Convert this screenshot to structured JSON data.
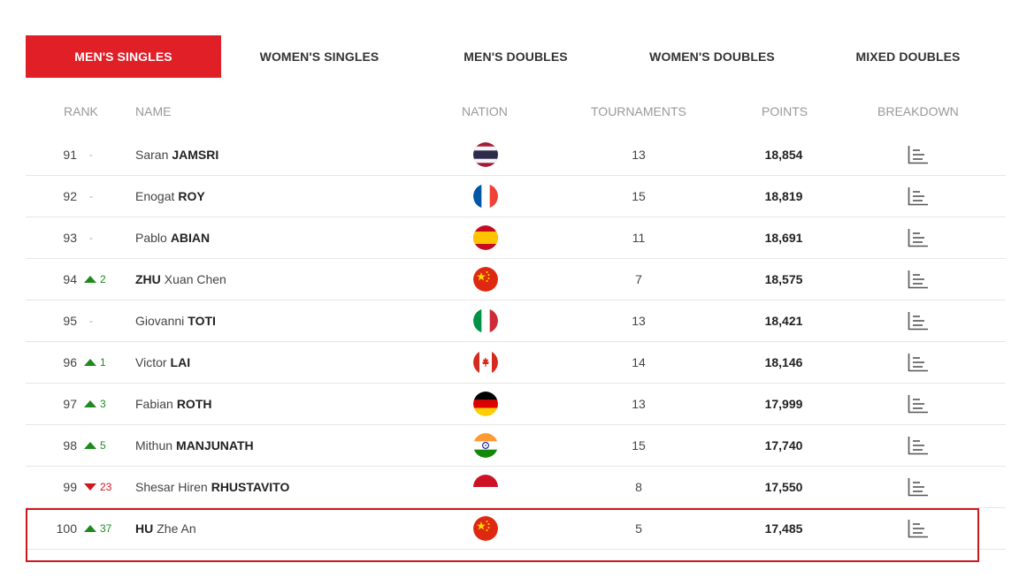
{
  "tabs": [
    {
      "label": "MEN'S SINGLES",
      "active": true
    },
    {
      "label": "WOMEN'S SINGLES",
      "active": false
    },
    {
      "label": "MEN'S DOUBLES",
      "active": false
    },
    {
      "label": "WOMEN'S DOUBLES",
      "active": false
    },
    {
      "label": "MIXED DOUBLES",
      "active": false
    }
  ],
  "columns": {
    "rank": "RANK",
    "name": "NAME",
    "nation": "NATION",
    "tournaments": "TOURNAMENTS",
    "points": "POINTS",
    "breakdown": "BREAKDOWN"
  },
  "rows": [
    {
      "rank": "91",
      "move_dir": "none",
      "move": "-",
      "name_first": "Saran",
      "name_first_bold": false,
      "name_last": "JAMSRI",
      "flag": "thailand",
      "tournaments": "13",
      "points": "18,854"
    },
    {
      "rank": "92",
      "move_dir": "none",
      "move": "-",
      "name_first": "Enogat",
      "name_first_bold": false,
      "name_last": "ROY",
      "flag": "france",
      "tournaments": "15",
      "points": "18,819"
    },
    {
      "rank": "93",
      "move_dir": "none",
      "move": "-",
      "name_first": "Pablo",
      "name_first_bold": false,
      "name_last": "ABIAN",
      "flag": "spain",
      "tournaments": "11",
      "points": "18,691"
    },
    {
      "rank": "94",
      "move_dir": "up",
      "move": "2",
      "name_first": "ZHU",
      "name_first_bold": true,
      "name_last": "Xuan Chen",
      "flag": "china",
      "tournaments": "7",
      "points": "18,575"
    },
    {
      "rank": "95",
      "move_dir": "none",
      "move": "-",
      "name_first": "Giovanni",
      "name_first_bold": false,
      "name_last": "TOTI",
      "flag": "italy",
      "tournaments": "13",
      "points": "18,421"
    },
    {
      "rank": "96",
      "move_dir": "up",
      "move": "1",
      "name_first": "Victor",
      "name_first_bold": false,
      "name_last": "LAI",
      "flag": "canada",
      "tournaments": "14",
      "points": "18,146"
    },
    {
      "rank": "97",
      "move_dir": "up",
      "move": "3",
      "name_first": "Fabian",
      "name_first_bold": false,
      "name_last": "ROTH",
      "flag": "germany",
      "tournaments": "13",
      "points": "17,999"
    },
    {
      "rank": "98",
      "move_dir": "up",
      "move": "5",
      "name_first": "Mithun",
      "name_first_bold": false,
      "name_last": "MANJUNATH",
      "flag": "india",
      "tournaments": "15",
      "points": "17,740"
    },
    {
      "rank": "99",
      "move_dir": "down",
      "move": "23",
      "name_first": "Shesar Hiren",
      "name_first_bold": false,
      "name_last": "RHUSTAVITO",
      "flag": "indonesia",
      "tournaments": "8",
      "points": "17,550"
    },
    {
      "rank": "100",
      "move_dir": "up",
      "move": "37",
      "name_first": "HU",
      "name_first_bold": true,
      "name_last": "Zhe An",
      "flag": "china",
      "tournaments": "5",
      "points": "17,485"
    }
  ],
  "colors": {
    "accent": "#e01f27",
    "up": "#1e8a1e",
    "down": "#d0161e",
    "highlight": "#d0161e"
  },
  "icons": {
    "breakdown": "bar-chart-icon",
    "move_up": "triangle-up-icon",
    "move_down": "triangle-down-icon"
  }
}
